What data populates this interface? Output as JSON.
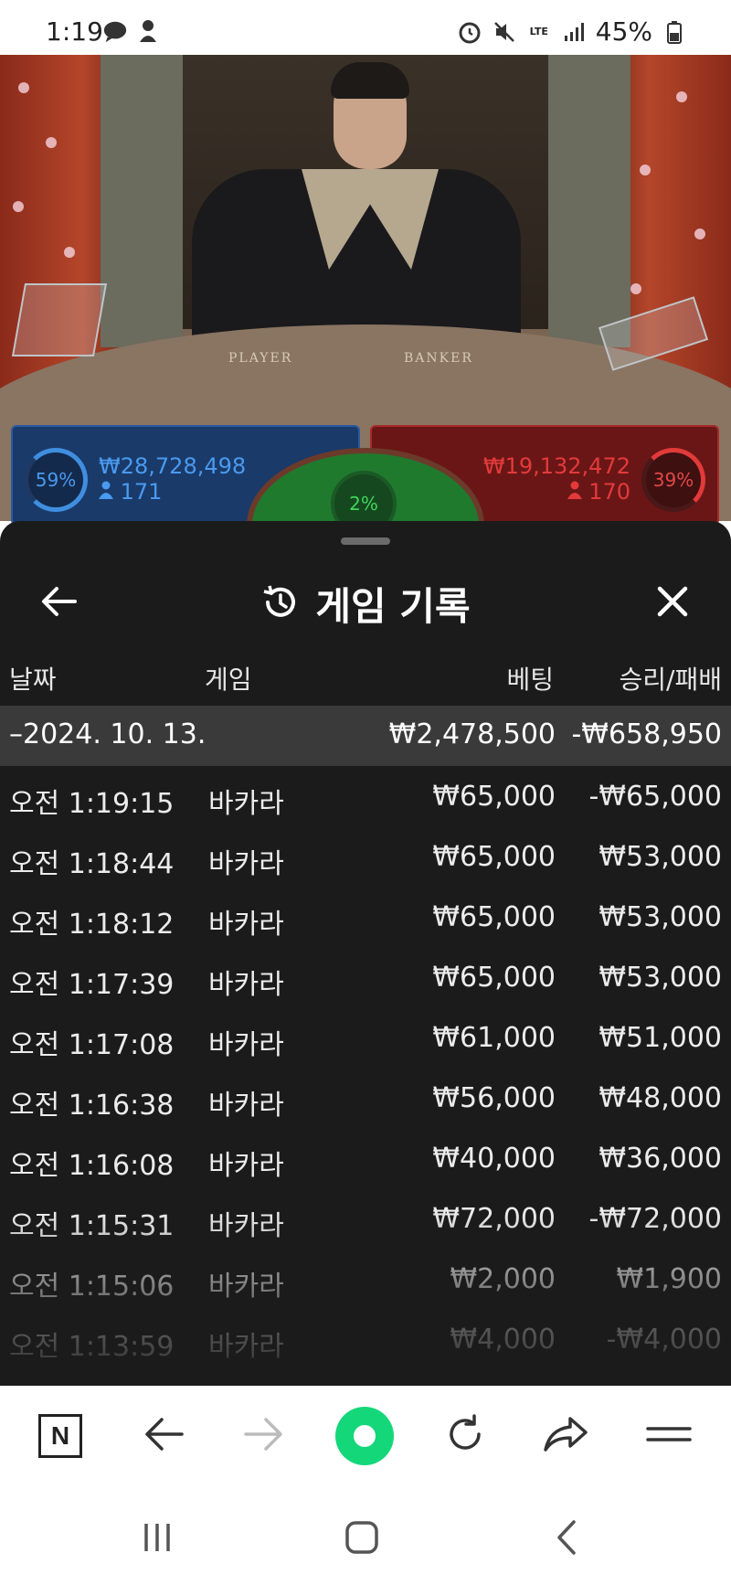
{
  "status_bar": {
    "time": "1:19",
    "network": "LTE",
    "battery": "45%",
    "left_icons": [
      "chat-bubble-icon",
      "weather-icon"
    ],
    "right_icons": [
      "alarm-icon",
      "mute-icon",
      "lte-icon",
      "signal-icon",
      "battery-icon"
    ]
  },
  "game": {
    "table_labels": {
      "player": "PLAYER",
      "banker": "BANKER"
    },
    "player": {
      "percent": "59%",
      "amount": "₩28,728,498",
      "count": "171",
      "color": "#3f8ee0"
    },
    "banker": {
      "percent": "39%",
      "amount": "₩19,132,472",
      "count": "170",
      "color": "#e23a3a"
    },
    "tie": {
      "percent": "2%",
      "color": "#3fd65a"
    }
  },
  "history": {
    "title": "게임 기록",
    "columns": {
      "date": "날짜",
      "game": "게임",
      "bet": "베팅",
      "result": "승리/패배"
    },
    "date_group": {
      "label": "–2024. 10. 13.",
      "bet_total": "₩2,478,500",
      "result_total": "-₩658,950"
    },
    "rows": [
      {
        "time": "오전 1:19:15",
        "game": "바카라",
        "bet": "₩65,000",
        "result": "-₩65,000"
      },
      {
        "time": "오전 1:18:44",
        "game": "바카라",
        "bet": "₩65,000",
        "result": "₩53,000"
      },
      {
        "time": "오전 1:18:12",
        "game": "바카라",
        "bet": "₩65,000",
        "result": "₩53,000"
      },
      {
        "time": "오전 1:17:39",
        "game": "바카라",
        "bet": "₩65,000",
        "result": "₩53,000"
      },
      {
        "time": "오전 1:17:08",
        "game": "바카라",
        "bet": "₩61,000",
        "result": "₩51,000"
      },
      {
        "time": "오전 1:16:38",
        "game": "바카라",
        "bet": "₩56,000",
        "result": "₩48,000"
      },
      {
        "time": "오전 1:16:08",
        "game": "바카라",
        "bet": "₩40,000",
        "result": "₩36,000"
      },
      {
        "time": "오전 1:15:31",
        "game": "바카라",
        "bet": "₩72,000",
        "result": "-₩72,000"
      },
      {
        "time": "오전 1:15:06",
        "game": "바카라",
        "bet": "₩2,000",
        "result": "₩1,900"
      },
      {
        "time": "오전 1:13:59",
        "game": "바카라",
        "bet": "₩4,000",
        "result": "-₩4,000"
      }
    ]
  },
  "browser_toolbar": {
    "home_letter": "N",
    "icons": [
      "naver-home-icon",
      "back-arrow-icon",
      "forward-arrow-icon",
      "green-dot-icon",
      "refresh-icon",
      "share-icon",
      "menu-icon"
    ],
    "accent": "#14d77a"
  },
  "system_nav": {
    "icons": [
      "recent-apps-icon",
      "home-icon",
      "back-icon"
    ]
  }
}
